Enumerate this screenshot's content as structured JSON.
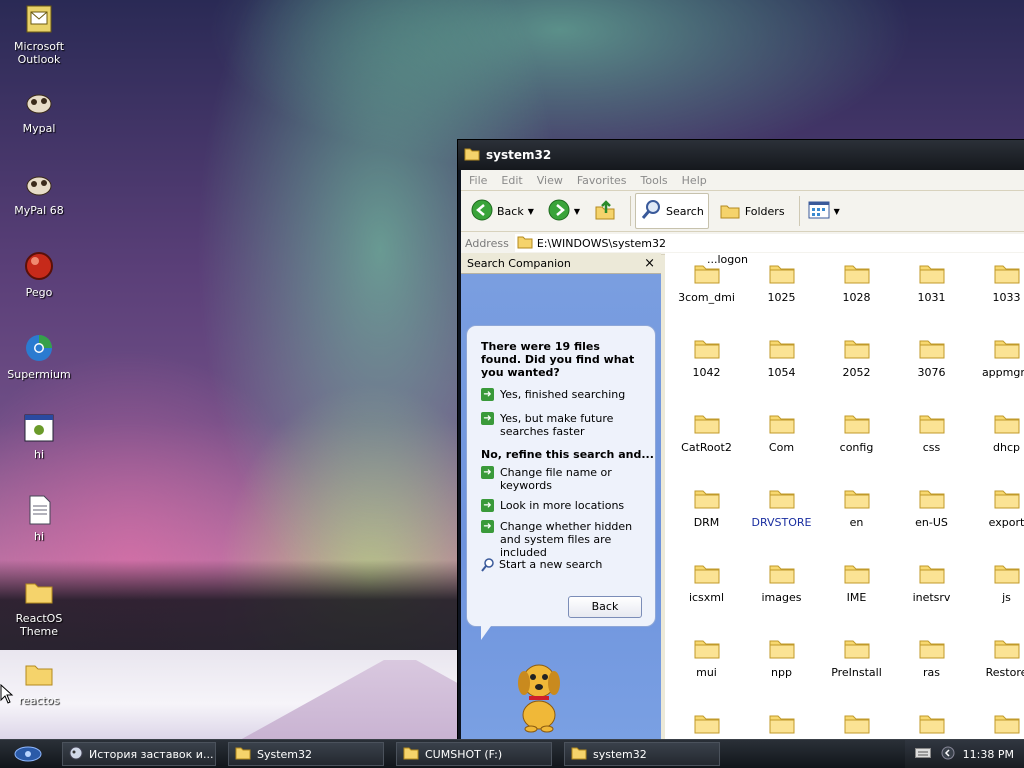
{
  "desktop": {
    "icons": [
      {
        "label": "Microsoft Outlook",
        "icon": "outlook-icon"
      },
      {
        "label": "Mypal",
        "icon": "mypal-icon"
      },
      {
        "label": "MyPal 68",
        "icon": "mypal-icon"
      },
      {
        "label": "Pego",
        "icon": "pego-icon"
      },
      {
        "label": "Supermium",
        "icon": "supermium-icon"
      },
      {
        "label": "hi",
        "icon": "program-window-icon"
      },
      {
        "label": "hi",
        "icon": "text-file-icon"
      },
      {
        "label": "ReactOS Theme",
        "icon": "folder-icon"
      },
      {
        "label": "reactos",
        "icon": "folder-icon"
      }
    ]
  },
  "window": {
    "title": "system32",
    "menu": [
      "File",
      "Edit",
      "View",
      "Favorites",
      "Tools",
      "Help"
    ],
    "toolbar": {
      "back": "Back",
      "search": "Search",
      "folders": "Folders"
    },
    "address": {
      "label": "Address",
      "path": "E:\\WINDOWS\\system32"
    },
    "search_companion": {
      "title": "Search Companion",
      "close": "×",
      "result": "There were 19 files found. Did you find what you wanted?",
      "opt1": "Yes, finished searching",
      "opt2": "Yes, but make future searches faster",
      "refine": "No, refine this search and...",
      "opt3": "Change file name or keywords",
      "opt4": "Look in more locations",
      "opt5": "Change whether hidden and system files are included",
      "opt6": "Start a new search",
      "back": "Back"
    },
    "files": {
      "partial_label": "...logon",
      "items": [
        "3com_dmi",
        "1025",
        "1028",
        "1031",
        "1033",
        "1042",
        "1054",
        "2052",
        "3076",
        "appmgm",
        "CatRoot2",
        "Com",
        "config",
        "css",
        "dhcp",
        "DRM",
        "DRVSTORE",
        "en",
        "en-US",
        "export",
        "icsxml",
        "images",
        "IME",
        "inetsrv",
        "js",
        "mui",
        "npp",
        "PreInstall",
        "ras",
        "Restore"
      ],
      "highlight_color": "#1a2ea0"
    }
  },
  "taskbar": {
    "tasks": [
      {
        "label": "История заставок и...",
        "icon": "browser-icon"
      },
      {
        "label": "System32",
        "icon": "folder-icon"
      },
      {
        "label": "CUMSHOT (F:)",
        "icon": "folder-icon"
      },
      {
        "label": "system32",
        "icon": "folder-icon"
      }
    ],
    "clock": "11:38 PM"
  }
}
